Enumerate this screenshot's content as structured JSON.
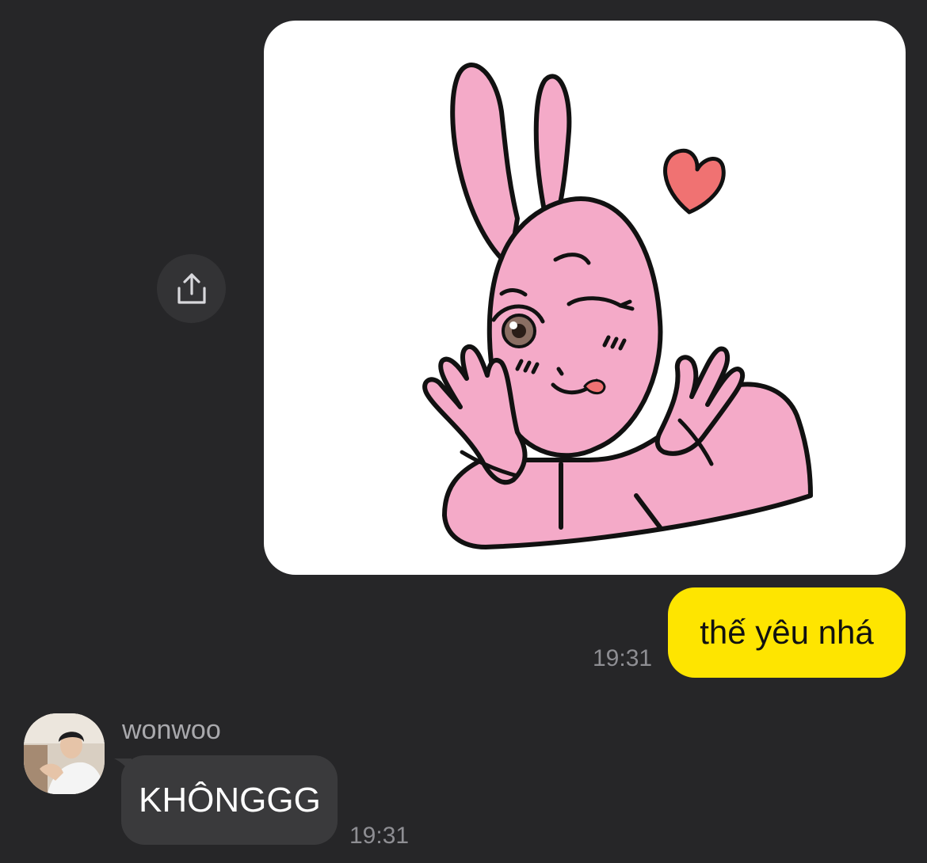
{
  "conversation": {
    "outgoing": {
      "sticker_icon": "pink-rabbit-wink-sticker",
      "message_text": "thế yêu nhá",
      "time": "19:31",
      "bubble_color": "#fee500"
    },
    "share_icon": "share-icon",
    "incoming": {
      "sender_name": "wonwoo",
      "message_text": "KHÔNGGG",
      "time": "19:31",
      "bubble_color": "#3a3a3c"
    }
  },
  "colors": {
    "background": "#262628",
    "rabbit_pink": "#f4aac8",
    "heart_red": "#f07272"
  }
}
